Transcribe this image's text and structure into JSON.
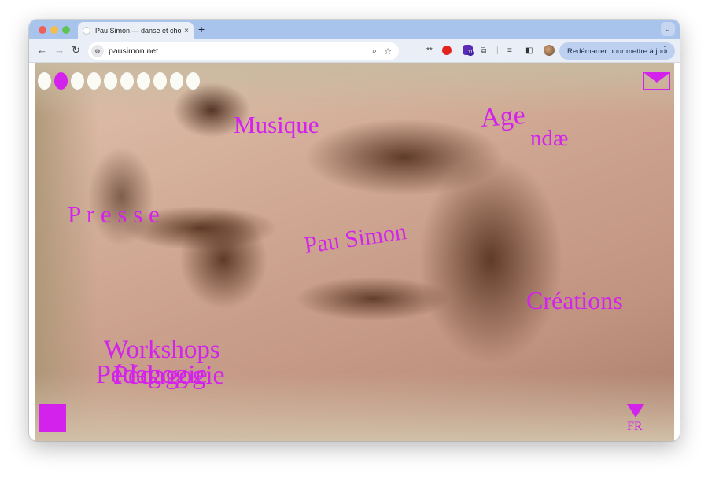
{
  "browser": {
    "tab_title": "Pau Simon — danse et chorég",
    "tab_close": "×",
    "new_tab": "+",
    "tab_menu": "⌄",
    "url": "pausimon.net",
    "restart_label": "Redémarrer pour mettre à jour",
    "restart_menu": "⋮",
    "badge_count": "11",
    "ext_glyph": "**"
  },
  "nav": {
    "musique": "Musique",
    "agenda_top": "Age",
    "agenda_bottom": "ndæ",
    "presse": "P r e s s e",
    "pau_simon": "Pau Simon",
    "creations": "Créations",
    "workshops": "Workshops",
    "pedagogie_1": "Pédagogie",
    "pedagogie_2": "Pédagogie",
    "lang": "FR"
  },
  "colors": {
    "accent": "#d322ec"
  },
  "slides": {
    "count": 10,
    "active": 2
  }
}
